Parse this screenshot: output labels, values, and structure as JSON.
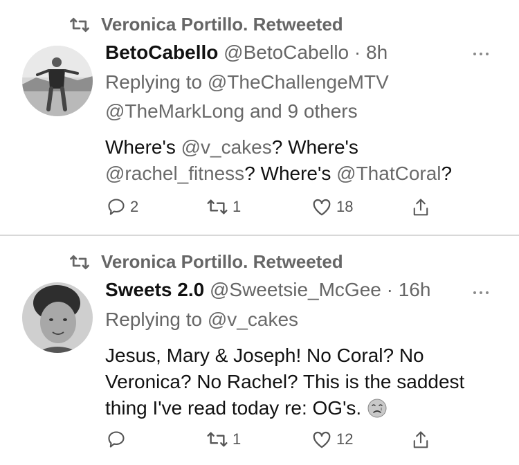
{
  "tweets": [
    {
      "retweeted_by": "Veronica Portillo. Retweeted",
      "name": "BetoCabello",
      "handle": "@BetoCabello",
      "separator": "·",
      "time": "8h",
      "replying_prefix": "Replying to ",
      "replying_mention": "@TheChallengeMTV",
      "replying_line2_mention": "@TheMarkLong",
      "replying_line2_suffix": " and 9 others",
      "body": {
        "p1": "Where's ",
        "m1": "@v_cakes",
        "p2": "? Where's ",
        "m2": "@rachel_fitness",
        "p3": "? Where's ",
        "m3": "@ThatCoral",
        "p4": "?"
      },
      "replies": "2",
      "retweets": "1",
      "likes": "18"
    },
    {
      "retweeted_by": "Veronica Portillo. Retweeted",
      "name": "Sweets 2.0",
      "handle": "@Sweetsie_McGee",
      "separator": "·",
      "time": "16h",
      "replying_prefix": "Replying to ",
      "replying_mention": "@v_cakes",
      "body_text": "Jesus, Mary & Joseph! No Coral? No Veronica? No Rachel? This is the saddest thing I've read today re: OG's.",
      "emoji": "crying-face-emoji",
      "replies": "",
      "retweets": "1",
      "likes": "12"
    }
  ],
  "icons": {
    "retweet": "retweet-icon",
    "reply": "reply-icon",
    "like": "heart-icon",
    "share": "share-icon",
    "more": "more-icon"
  }
}
